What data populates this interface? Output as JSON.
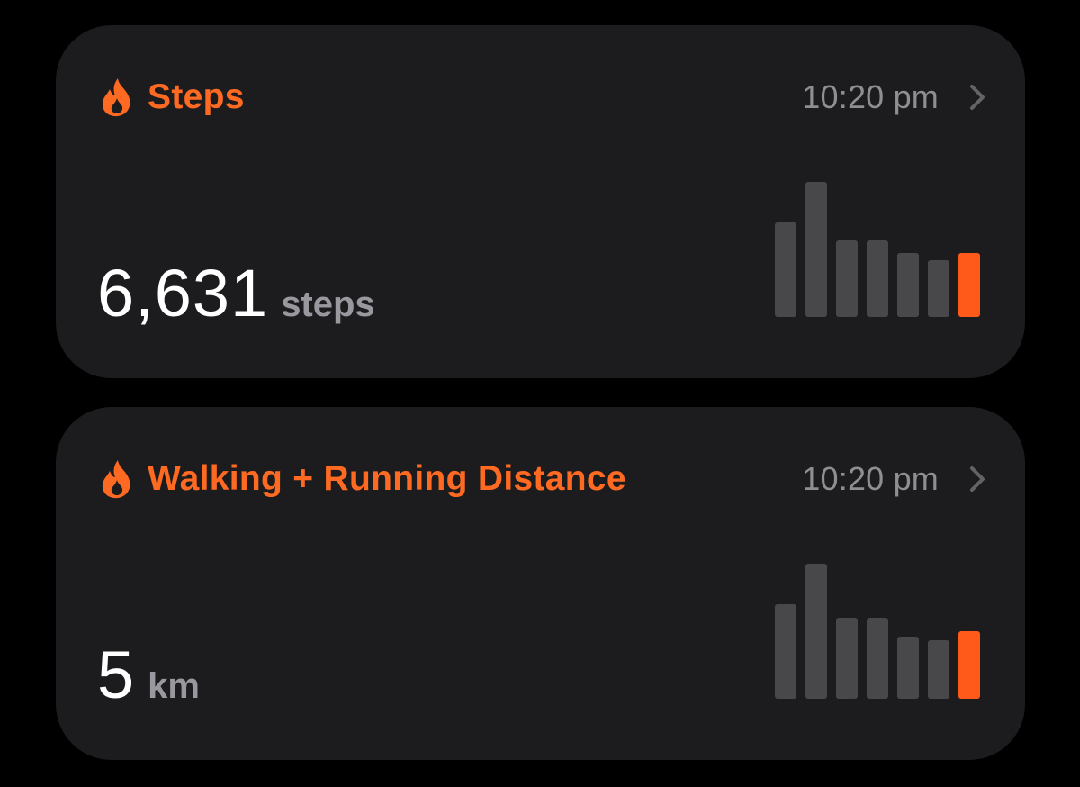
{
  "colors": {
    "accent": "#ff6a22",
    "bar_inactive": "#48484a",
    "bar_current": "#ff5a1a",
    "card_bg": "#1c1c1e",
    "secondary_text": "#8e8e93"
  },
  "cards": [
    {
      "icon": "flame-icon",
      "title": "Steps",
      "time": "10:20 pm",
      "value": "6,631",
      "unit": "steps",
      "bars": [
        0.7,
        1.0,
        0.57,
        0.57,
        0.47,
        0.42,
        0.47
      ]
    },
    {
      "icon": "flame-icon",
      "title": "Walking + Running Distance",
      "time": "10:20 pm",
      "value": "5",
      "unit": "km",
      "bars": [
        0.7,
        1.0,
        0.6,
        0.6,
        0.46,
        0.43,
        0.5
      ]
    }
  ]
}
